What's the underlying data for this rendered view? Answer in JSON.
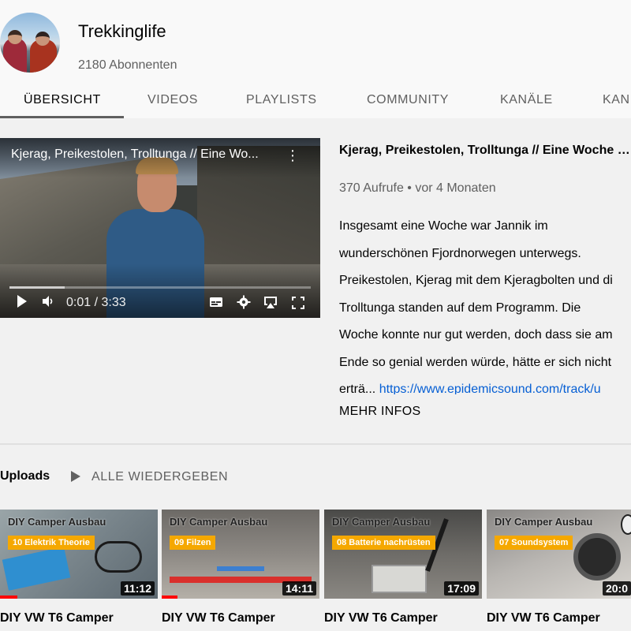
{
  "channel": {
    "name": "Trekkinglife",
    "subscribers": "2180 Abonnenten"
  },
  "tabs": [
    {
      "label": "ÜBERSICHT",
      "active": true
    },
    {
      "label": "VIDEOS"
    },
    {
      "label": "PLAYLISTS"
    },
    {
      "label": "COMMUNITY"
    },
    {
      "label": "KANÄLE"
    },
    {
      "label": "KAN"
    }
  ],
  "featured": {
    "player_title": "Kjerag, Preikestolen, Trolltunga // Eine Wo...",
    "time": "0:01 / 3:33",
    "title": "Kjerag, Preikestolen, Trolltunga // Eine Woche d...",
    "meta": "370 Aufrufe • vor 4 Monaten",
    "description_lines": [
      "Insgesamt eine Woche war Jannik im",
      "wunderschönen Fjordnorwegen unterwegs.",
      "Preikestolen, Kjerag mit dem Kjeragbolten und di",
      "Trolltunga standen auf dem Programm. Die",
      "Woche konnte nur gut werden, doch dass sie am",
      "Ende so genial werden würde, hätte er sich nicht",
      "erträ..."
    ],
    "description_link": "https://www.epidemicsound.com/track/u",
    "more_label": "MEHR INFOS"
  },
  "uploads": {
    "title": "Uploads",
    "play_all": "ALLE WIEDERGEBEN",
    "videos": [
      {
        "series": "DIY Camper Ausbau",
        "badge": "10 Elektrik Theorie",
        "duration": "11:12",
        "title": "DIY VW T6 Camper",
        "watched_pct": 11
      },
      {
        "series": "DIY Camper Ausbau",
        "badge": "09 Filzen",
        "duration": "14:11",
        "title": "DIY VW T6 Camper",
        "watched_pct": 10
      },
      {
        "series": "DIY Camper Ausbau",
        "badge": "08 Batterie nachrüsten",
        "duration": "17:09",
        "title": "DIY VW T6 Camper",
        "watched_pct": 0
      },
      {
        "series": "DIY Camper Ausbau",
        "badge": "07 Soundsystem",
        "duration": "20:0",
        "title": "DIY VW T6 Camper",
        "watched_pct": 0
      }
    ]
  }
}
